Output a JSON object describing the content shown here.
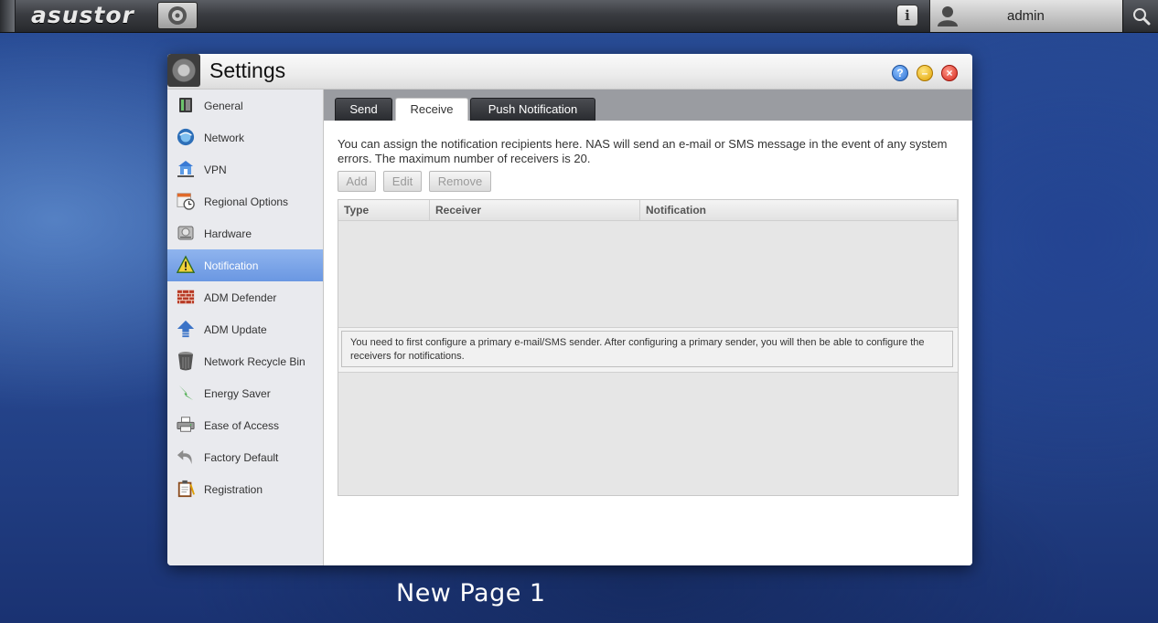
{
  "topbar": {
    "logo_text": "asustor",
    "user_name": "admin"
  },
  "window": {
    "title": "Settings",
    "controls": {
      "help": "?",
      "minimize": "–",
      "close": "×"
    }
  },
  "sidebar": {
    "items": [
      {
        "label": "General",
        "icon": "server-icon"
      },
      {
        "label": "Network",
        "icon": "globe-icon"
      },
      {
        "label": "VPN",
        "icon": "vpn-icon"
      },
      {
        "label": "Regional Options",
        "icon": "calendar-clock-icon"
      },
      {
        "label": "Hardware",
        "icon": "hard-drive-icon"
      },
      {
        "label": "Notification",
        "icon": "warning-icon",
        "active": true
      },
      {
        "label": "ADM Defender",
        "icon": "firewall-icon"
      },
      {
        "label": "ADM Update",
        "icon": "up-arrow-icon"
      },
      {
        "label": "Network Recycle Bin",
        "icon": "trash-can-icon"
      },
      {
        "label": "Energy Saver",
        "icon": "lightning-icon"
      },
      {
        "label": "Ease of Access",
        "icon": "printer-icon"
      },
      {
        "label": "Factory Default",
        "icon": "undo-icon"
      },
      {
        "label": "Registration",
        "icon": "clipboard-icon"
      }
    ]
  },
  "tabs": [
    {
      "label": "Send",
      "active": false
    },
    {
      "label": "Receive",
      "active": true
    },
    {
      "label": "Push Notification",
      "active": false
    }
  ],
  "content": {
    "description": "You can assign the notification recipients here. NAS will send an e-mail or SMS message in the event of any system errors. The maximum number of receivers is 20.",
    "buttons": {
      "add": "Add",
      "edit": "Edit",
      "remove": "Remove"
    },
    "columns": [
      "Type",
      "Receiver",
      "Notification"
    ],
    "message": "You need to first configure a primary e-mail/SMS sender. After configuring a primary sender, you will then be able to configure the receivers for notifications."
  },
  "caption": "New Page 1",
  "colors": {
    "active_item": "#7aa5e8",
    "tab_dark": "#2f3135",
    "close": "#d5251a",
    "minimize": "#e0a000",
    "help": "#2a6fd1"
  }
}
